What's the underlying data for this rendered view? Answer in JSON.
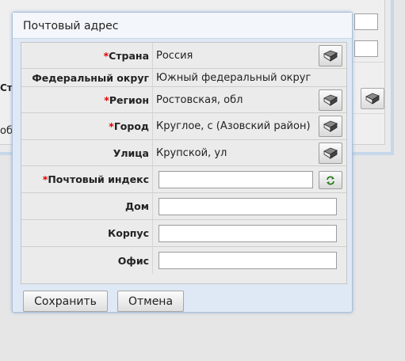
{
  "background": {
    "label_fragment": "Ст",
    "button_fragment": "об"
  },
  "dialog": {
    "title": "Почтовый адрес",
    "required_mark": "*",
    "fields": {
      "country": {
        "label": "Страна",
        "value": "Россия",
        "required": true
      },
      "federal_district": {
        "label": "Федеральный округ",
        "value": "Южный федеральный округ",
        "required": false
      },
      "region": {
        "label": "Регион",
        "value": "Ростовская, обл",
        "required": true
      },
      "city": {
        "label": "Город",
        "value": "Круглое, с (Азовский район)",
        "required": true
      },
      "street": {
        "label": "Улица",
        "value": "Крупской, ул",
        "required": false
      },
      "postal_code": {
        "label": "Почтовый индекс",
        "value": "",
        "required": true
      },
      "house": {
        "label": "Дом",
        "value": "",
        "required": false
      },
      "building": {
        "label": "Корпус",
        "value": "",
        "required": false
      },
      "office": {
        "label": "Офис",
        "value": "",
        "required": false
      }
    },
    "buttons": {
      "save": "Сохранить",
      "cancel": "Отмена"
    }
  },
  "icons": {
    "lookup": "book-icon",
    "refresh": "refresh-icon"
  }
}
